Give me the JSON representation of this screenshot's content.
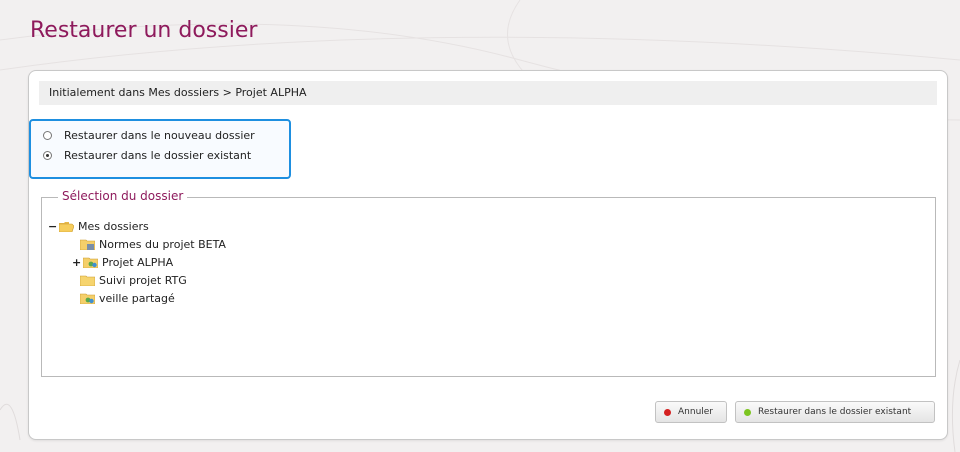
{
  "page": {
    "title": "Restaurer un dossier"
  },
  "origin": {
    "text": "Initialement dans Mes dossiers > Projet ALPHA"
  },
  "restore_options": [
    {
      "label": "Restaurer dans le nouveau dossier",
      "selected": false
    },
    {
      "label": "Restaurer dans le dossier existant",
      "selected": true
    }
  ],
  "folder_selection": {
    "legend": "Sélection du dossier",
    "root": {
      "label": "Mes dossiers",
      "toggle": "−",
      "icon": "open-folder-icon"
    },
    "children": [
      {
        "label": "Normes du projet BETA",
        "toggle": "",
        "icon": "shared-folder-icon"
      },
      {
        "label": "Projet ALPHA",
        "toggle": "+",
        "icon": "shared-users-folder-icon"
      },
      {
        "label": "Suivi projet RTG",
        "toggle": "",
        "icon": "folder-icon"
      },
      {
        "label": "veille partagé",
        "toggle": "",
        "icon": "shared-users-folder-icon"
      }
    ]
  },
  "buttons": {
    "cancel": {
      "label": "Annuler",
      "color": "#d42020"
    },
    "restore": {
      "label": "Restaurer dans le dossier existant",
      "color": "#7cc520"
    }
  },
  "colors": {
    "title": "#8e1a5c",
    "selection_border": "#1e8fe0"
  }
}
